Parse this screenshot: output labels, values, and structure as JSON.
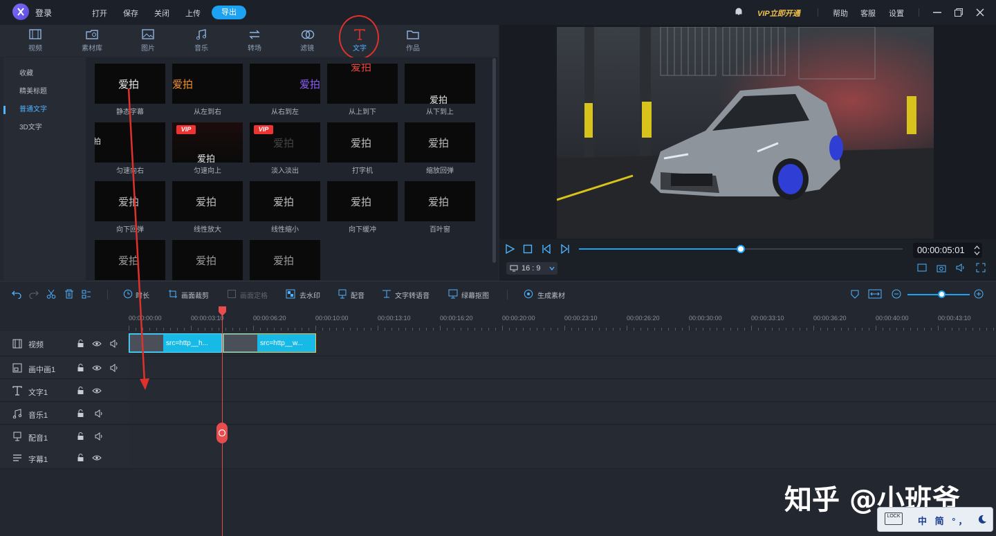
{
  "topbar": {
    "login": "登录",
    "menu": [
      "打开",
      "保存",
      "关闭",
      "上传"
    ],
    "export": "导出",
    "vip": "VIP立即开通",
    "right": [
      "帮助",
      "客服",
      "设置"
    ]
  },
  "tabs": [
    {
      "label": "视频",
      "icon": "film-icon"
    },
    {
      "label": "素材库",
      "icon": "folder-camera-icon"
    },
    {
      "label": "图片",
      "icon": "image-icon"
    },
    {
      "label": "音乐",
      "icon": "music-icon"
    },
    {
      "label": "转场",
      "icon": "transition-icon"
    },
    {
      "label": "滤镜",
      "icon": "filter-icon"
    },
    {
      "label": "文字",
      "icon": "text-icon",
      "active": true
    },
    {
      "label": "作品",
      "icon": "folder-icon"
    }
  ],
  "categories": [
    "收藏",
    "精美标题",
    "普通文字",
    "3D文字"
  ],
  "active_category": "普通文字",
  "templates": [
    {
      "name": "静态字幕",
      "text": "爱拍"
    },
    {
      "name": "从左到右",
      "text": "爱拍"
    },
    {
      "name": "从右到左",
      "text": "爱拍"
    },
    {
      "name": "从上到下",
      "text": "爱拍"
    },
    {
      "name": "从下到上",
      "text": "爱拍"
    },
    {
      "name": "匀速向右",
      "text": "拍"
    },
    {
      "name": "匀速向上",
      "text": "爱拍",
      "vip": "VIP"
    },
    {
      "name": "淡入淡出",
      "text": "爱拍",
      "vip": "VIP"
    },
    {
      "name": "打字机",
      "text": "爱拍"
    },
    {
      "name": "缩放回弹",
      "text": "爱拍"
    },
    {
      "name": "向下回弹",
      "text": "爱拍"
    },
    {
      "name": "线性放大",
      "text": "爱拍"
    },
    {
      "name": "线性缩小",
      "text": "爱拍"
    },
    {
      "name": "向下缓冲",
      "text": "爱拍"
    },
    {
      "name": "百叶窗",
      "text": "爱拍"
    },
    {
      "name": "",
      "text": "爱拍"
    },
    {
      "name": "",
      "text": "爱拍"
    },
    {
      "name": "",
      "text": "爱拍"
    }
  ],
  "player": {
    "time": "00:00:05:01",
    "ratio": "16 : 9",
    "progress": 0.5
  },
  "toolbar": {
    "buttons": [
      "时长",
      "画面裁剪",
      "画面定格",
      "去水印",
      "配音",
      "文字转语音",
      "绿幕抠图",
      "生成素材"
    ]
  },
  "ruler": [
    "00:00:00:00",
    "00:00:03:10",
    "00:00:06:20",
    "00:00:10:00",
    "00:00:13:10",
    "00:00:16:20",
    "00:00:20:00",
    "00:00:23:10",
    "00:00:26:20",
    "00:00:30:00",
    "00:00:33:10",
    "00:00:36:20",
    "00:00:40:00",
    "00:00:43:10"
  ],
  "tracks": [
    {
      "name": "视频",
      "icon": "film-icon"
    },
    {
      "name": "画中画1",
      "icon": "pip-icon"
    },
    {
      "name": "文字1",
      "icon": "text-icon"
    },
    {
      "name": "音乐1",
      "icon": "music-icon"
    },
    {
      "name": "配音1",
      "icon": "mic-icon"
    },
    {
      "name": "字幕1",
      "icon": "subtitle-icon"
    }
  ],
  "clips": [
    "src=http__h...",
    "src=http__w..."
  ],
  "watermark": "知乎 @小班爷",
  "ime": {
    "text": "中 简 °，",
    "lock": "LOCK"
  },
  "colors": {
    "accent": "#1da1f2",
    "annotation": "#e0322c",
    "clip": "#17b9e6",
    "vip": "#f2c14e"
  }
}
